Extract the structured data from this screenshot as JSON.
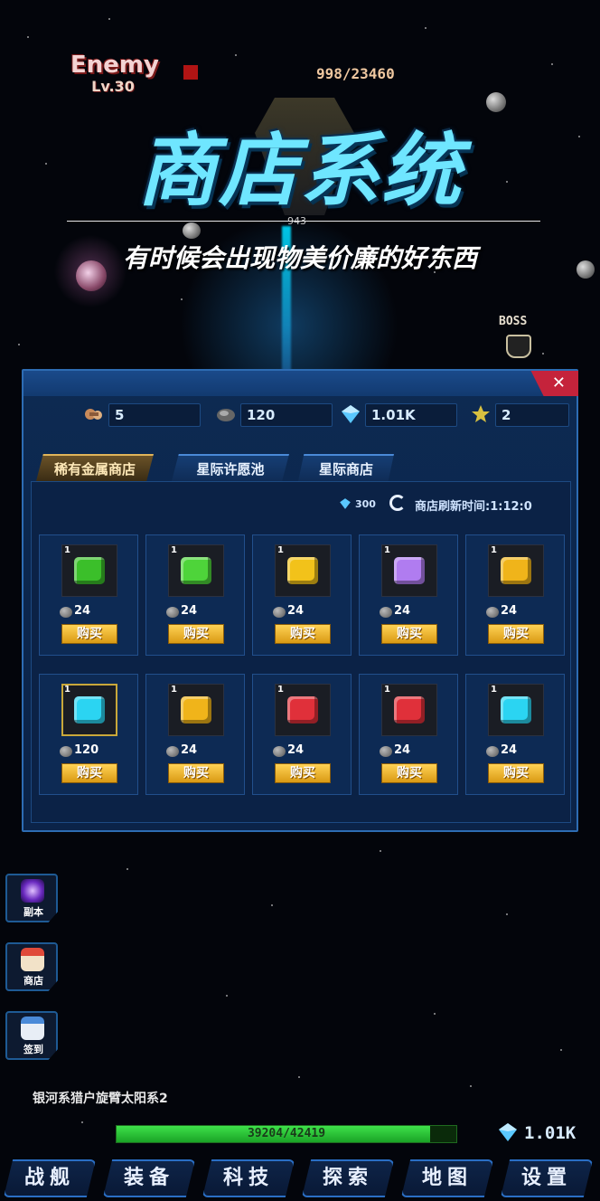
{
  "enemy": {
    "name": "Enemy",
    "level": "Lv.30",
    "hp": "998/23460"
  },
  "ship_hp": "943",
  "boss_label": "BOSS",
  "promo": {
    "title": "商店系统",
    "subtitle": "有时候会出现物美价廉的好东西"
  },
  "resources": [
    {
      "icon": "ore-capsule-icon",
      "value": "5"
    },
    {
      "icon": "metal-ore-icon",
      "value": "120"
    },
    {
      "icon": "diamond-icon",
      "value": "1.01K"
    },
    {
      "icon": "star-icon",
      "value": "2"
    }
  ],
  "tabs": [
    {
      "label": "稀有金属商店",
      "active": true
    },
    {
      "label": "星际许愿池",
      "active": false
    },
    {
      "label": "星际商店",
      "active": false
    }
  ],
  "refresh": {
    "cost": "300",
    "label": "商店刷新时间:1:12:0"
  },
  "items": [
    {
      "qty": "1",
      "icon": "green-spring-part-icon",
      "cost": "24",
      "buy": "购买",
      "color": "#3bbf2a",
      "framed": false
    },
    {
      "qty": "1",
      "icon": "green-armor-block-icon",
      "cost": "24",
      "buy": "购买",
      "color": "#4ed43a",
      "framed": false
    },
    {
      "qty": "1",
      "icon": "yellow-capsule-icon",
      "cost": "24",
      "buy": "购买",
      "color": "#f2c21a",
      "framed": false
    },
    {
      "qty": "1",
      "icon": "purple-armor-block-icon",
      "cost": "24",
      "buy": "购买",
      "color": "#b07cf0",
      "framed": false
    },
    {
      "qty": "1",
      "icon": "yellow-pen-part-icon",
      "cost": "24",
      "buy": "购买",
      "color": "#f0b41a",
      "framed": false
    },
    {
      "qty": "1",
      "icon": "cyan-armor-block-icon",
      "cost": "120",
      "buy": "购买",
      "color": "#2bd4f2",
      "framed": true
    },
    {
      "qty": "1",
      "icon": "yellow-pen-part-icon",
      "cost": "24",
      "buy": "购买",
      "color": "#f0b41a",
      "framed": false
    },
    {
      "qty": "1",
      "icon": "red-ship-part-icon",
      "cost": "24",
      "buy": "购买",
      "color": "#e0303a",
      "framed": false
    },
    {
      "qty": "1",
      "icon": "red-cannon-part-icon",
      "cost": "24",
      "buy": "购买",
      "color": "#e0303a",
      "framed": false
    },
    {
      "qty": "1",
      "icon": "cyan-armor-block-icon",
      "cost": "24",
      "buy": "购买",
      "color": "#2bd4f2",
      "framed": false
    }
  ],
  "side_buttons": [
    {
      "label": "副本",
      "icon": "vortex-icon"
    },
    {
      "label": "商店",
      "icon": "shop-icon"
    },
    {
      "label": "签到",
      "icon": "calendar-icon"
    }
  ],
  "location": "银河系猎户旋臂太阳系2",
  "xp": {
    "text": "39204/42419",
    "fraction": 0.924
  },
  "gems": "1.01K",
  "nav": [
    {
      "label": "战舰"
    },
    {
      "label": "装备"
    },
    {
      "label": "科技"
    },
    {
      "label": "探索"
    },
    {
      "label": "地图"
    },
    {
      "label": "设置"
    }
  ]
}
